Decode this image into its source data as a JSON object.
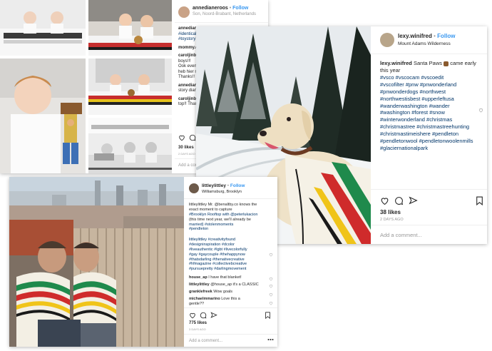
{
  "post1": {
    "username": "annedianeroos",
    "follow": "Follow",
    "location": "Son, Noord-Brabant, Netherlands",
    "comments": [
      {
        "user": "annedianeroos",
        "text": "#identical",
        "tag": "#toystory"
      },
      {
        "user": "mommy.d",
        "text": ""
      },
      {
        "user": "caroljinbar",
        "lines": [
          "boys!!!",
          "Ook even",
          "heb hier m",
          "Thanks!!"
        ]
      },
      {
        "user": "annedianer",
        "lines": [
          "story dianer"
        ]
      },
      {
        "user": "caroljinbar",
        "lines": [
          "top!! Thar"
        ]
      }
    ],
    "likes": "30 likes",
    "time": "2 DAYS AGO",
    "add_comment": "Add a comm"
  },
  "post2": {
    "username": "lexy.winifred",
    "separator": "•",
    "follow": "Follow",
    "location": "Mount Adams Wilderness",
    "caption_user": "lexy.winifred",
    "caption_text": "Santa Paws",
    "caption_tail": "came early this year",
    "hashtags": [
      "#vsco #vscocam #vscoedit",
      "#vscofilter #pnw #pnwonderland",
      "#pnwonderdogs #northwest",
      "#northwestisbest #upperleftusa",
      "#wanderwashington #wander",
      "#washington #forest #snow",
      "#winterwonderland #christmas",
      "#christmastree #christmastreehunting",
      "#christmastimeishere #pendleton",
      "#pendletonwool #pendletonwoolenmills",
      "#glaciernationalpark"
    ],
    "likes": "38 likes",
    "time": "2 DAYS AGO",
    "add_comment": "Add a comment..."
  },
  "post3": {
    "username": "littleylittley",
    "separator": "•",
    "follow": "Follow",
    "location": "Williamsburg, Brooklyn",
    "caption_lines": [
      "littleylittley Mr. @benaltby.co knows the",
      "exact moment to capture",
      "#Brooklyn Rooftop with @peterlukacion",
      "(this time next year, we'll already be",
      "married) #stolenmoments",
      "#pendleton"
    ],
    "hashtags": [
      "littleylittley #creativityfound",
      "#designinspiration #dcolor",
      "#liveauthentic #lgbt #livecolorfully",
      "#gay #gaycouple #thehappynow",
      "#thatsdarling #thenativecreative",
      "#hfmagazine #collectivebcreative",
      "#pursuepretty #darlingmovement"
    ],
    "comments": [
      {
        "user": "house_ap",
        "text": "I have that blanket!"
      },
      {
        "user": "littleylittley",
        "text": "@house_ap it's a CLASSIC"
      },
      {
        "user": "granklefreek",
        "text": "Wow goals"
      },
      {
        "user": "michaelmmarino",
        "text": "Love this a"
      },
      {
        "user": "",
        "text": "gentle??"
      }
    ],
    "likes": "775 likes",
    "time": "3 DAYS AGO",
    "add_comment": "Add a comment..."
  },
  "colors": {
    "link_blue": "#3897f0",
    "hashtag": "#003569",
    "muted": "#999999",
    "pendleton_green": "#1f8a4c",
    "pendleton_red": "#cf2b2b",
    "pendleton_yellow": "#f0c419",
    "pendleton_black": "#1a1a1a"
  },
  "icons": [
    "heart-icon",
    "comment-icon",
    "share-icon",
    "bookmark-icon",
    "more-icon"
  ]
}
